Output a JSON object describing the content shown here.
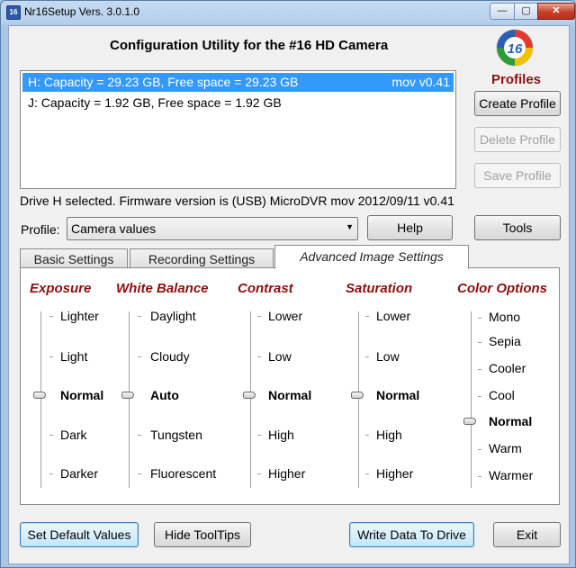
{
  "window": {
    "title": "Nr16Setup  Vers. 3.0.1.0",
    "icon_text": "16",
    "controls": {
      "minimize": "—",
      "maximize": "▢",
      "close": "✕"
    }
  },
  "header": {
    "heading": "Configuration Utility for the #16 HD Camera",
    "logo_text": "16",
    "profiles_label": "Profiles"
  },
  "drives": [
    {
      "text": "H:  Capacity = 29.23 GB, Free space = 29.23 GB",
      "version": "mov v0.41",
      "selected": true
    },
    {
      "text": "J:  Capacity = 1.92 GB, Free space = 1.92 GB",
      "version": "",
      "selected": false
    }
  ],
  "profile_buttons": {
    "create": "Create Profile",
    "delete": "Delete Profile",
    "save": "Save Profile"
  },
  "status_text": "Drive H selected. Firmware version is (USB) MicroDVR mov 2012/09/11 v0.41",
  "profile": {
    "label": "Profile:",
    "selected": "Camera values",
    "help": "Help",
    "tools": "Tools"
  },
  "tabs": [
    "Basic Settings",
    "Recording Settings",
    "Advanced Image Settings"
  ],
  "active_tab": "Advanced Image Settings",
  "settings": [
    {
      "title": "Exposure",
      "options": [
        "Lighter",
        "Light",
        "Normal",
        "Dark",
        "Darker"
      ],
      "selected": "Normal"
    },
    {
      "title": "White Balance",
      "options": [
        "Daylight",
        "Cloudy",
        "Auto",
        "Tungsten",
        "Fluorescent"
      ],
      "selected": "Auto"
    },
    {
      "title": "Contrast",
      "options": [
        "Lower",
        "Low",
        "Normal",
        "High",
        "Higher"
      ],
      "selected": "Normal"
    },
    {
      "title": "Saturation",
      "options": [
        "Lower",
        "Low",
        "Normal",
        "High",
        "Higher"
      ],
      "selected": "Normal"
    },
    {
      "title": "Color Options",
      "options": [
        "Mono",
        "Sepia",
        "Cooler",
        "Cool",
        "Normal",
        "Warm",
        "Warmer"
      ],
      "selected": "Normal"
    }
  ],
  "bottom_buttons": {
    "defaults": "Set Default Values",
    "tooltips": "Hide ToolTips",
    "write": "Write Data To Drive",
    "exit": "Exit"
  },
  "colors": {
    "accent_red": "#8b1010",
    "selection_blue": "#3399ff"
  }
}
